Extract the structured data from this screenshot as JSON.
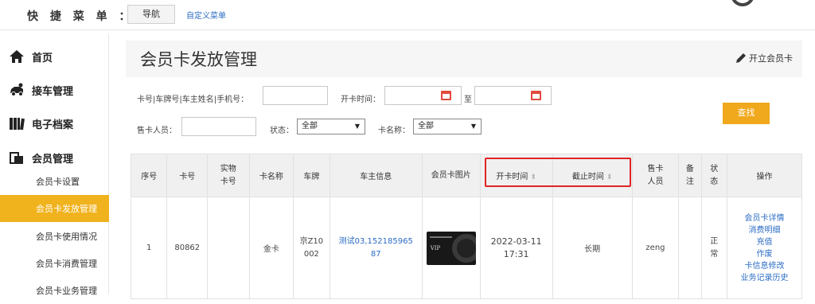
{
  "topbar": {
    "quick_menu_label": "快 捷 菜 单 ：",
    "nav_button": "导航",
    "custom_menu_link": "自定义菜单"
  },
  "sidebar": {
    "items": [
      {
        "label": "首页",
        "icon": "home-icon"
      },
      {
        "label": "接车管理",
        "icon": "car-icon"
      },
      {
        "label": "电子档案",
        "icon": "books-icon"
      },
      {
        "label": "会员管理",
        "icon": "member-card-icon"
      }
    ],
    "sub_items": [
      {
        "label": "会员卡设置",
        "active": false
      },
      {
        "label": "会员卡发放管理",
        "active": true
      },
      {
        "label": "会员卡使用情况",
        "active": false
      },
      {
        "label": "会员卡消费管理",
        "active": false
      },
      {
        "label": "会员卡业务管理",
        "active": false
      }
    ],
    "active_color": "#f0b21d"
  },
  "page": {
    "title": "会员卡发放管理",
    "open_card_button": "开立会员卡"
  },
  "filters": {
    "card_search_label": "卡号|车牌号|车主姓名|手机号：",
    "card_search_value": "",
    "open_time_label": "开卡时间：",
    "open_time_from": "",
    "to_label": "至",
    "open_time_to": "",
    "seller_label": "售卡人员：",
    "seller_value": "",
    "status_label": "状态：",
    "status_selected": "全部",
    "card_name_label": "卡名称：",
    "card_name_selected": "全部",
    "search_button": "查找",
    "search_button_color": "#f0a81c"
  },
  "table": {
    "headers": {
      "seq": "序号",
      "card_no": "卡号",
      "physical_card_no": "实物卡号",
      "card_name": "卡名称",
      "plate": "车牌",
      "owner_info": "车主信息",
      "card_image": "会员卡图片",
      "open_time": "开卡时间",
      "expire_time": "截止时间",
      "seller": "售卡人员",
      "remark": "备注",
      "status": "状态",
      "actions": "操作"
    },
    "rows": [
      {
        "seq": "1",
        "card_no": "80862",
        "physical_card_no": "",
        "card_name": "金卡",
        "plate": "京Z10002",
        "owner_info": "测试03,15218596587",
        "card_image_text": "VIP",
        "open_time": "2022-03-11 17:31",
        "expire_time": "长期",
        "seller": "zeng",
        "remark": "",
        "status": "正常",
        "actions": [
          "会员卡详情",
          "消费明细",
          "充值",
          "作废",
          "卡信息修改",
          "业务记录历史"
        ]
      }
    ],
    "highlight_color": "#e02525"
  }
}
